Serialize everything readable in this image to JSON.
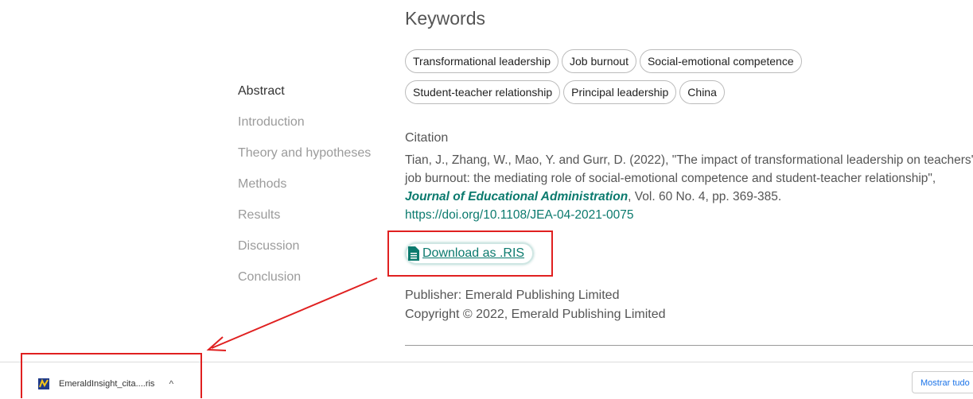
{
  "keywords": {
    "title": "Keywords",
    "row1": [
      "Transformational leadership",
      "Job burnout",
      "Social-emotional competence"
    ],
    "row2": [
      "Student-teacher relationship",
      "Principal leadership",
      "China"
    ]
  },
  "toc": [
    "Abstract",
    "Introduction",
    "Theory and hypotheses",
    "Methods",
    "Results",
    "Discussion",
    "Conclusion"
  ],
  "citation": {
    "label": "Citation",
    "pre": "Tian, J., Zhang, W., Mao, Y. and Gurr, D. (2022), \"The impact of transformational leadership on teachers' job burnout: the mediating role of social-emotional competence and student-teacher relationship\", ",
    "journal": "Journal of Educational Administration",
    "post": ", Vol. 60 No. 4, pp. 369-385.",
    "doi": "https://doi.org/10.1108/JEA-04-2021-0075"
  },
  "download": {
    "label": "Download as .RIS"
  },
  "publisher": {
    "line1": "Publisher: Emerald Publishing Limited",
    "line2": "Copyright © 2022, Emerald Publishing Limited"
  },
  "download_bar": {
    "file_name": "EmeraldInsight_cita....ris",
    "show_all": "Mostrar tudo"
  },
  "colors": {
    "accent": "#0b7a6e",
    "annotation_red": "#e02020"
  }
}
